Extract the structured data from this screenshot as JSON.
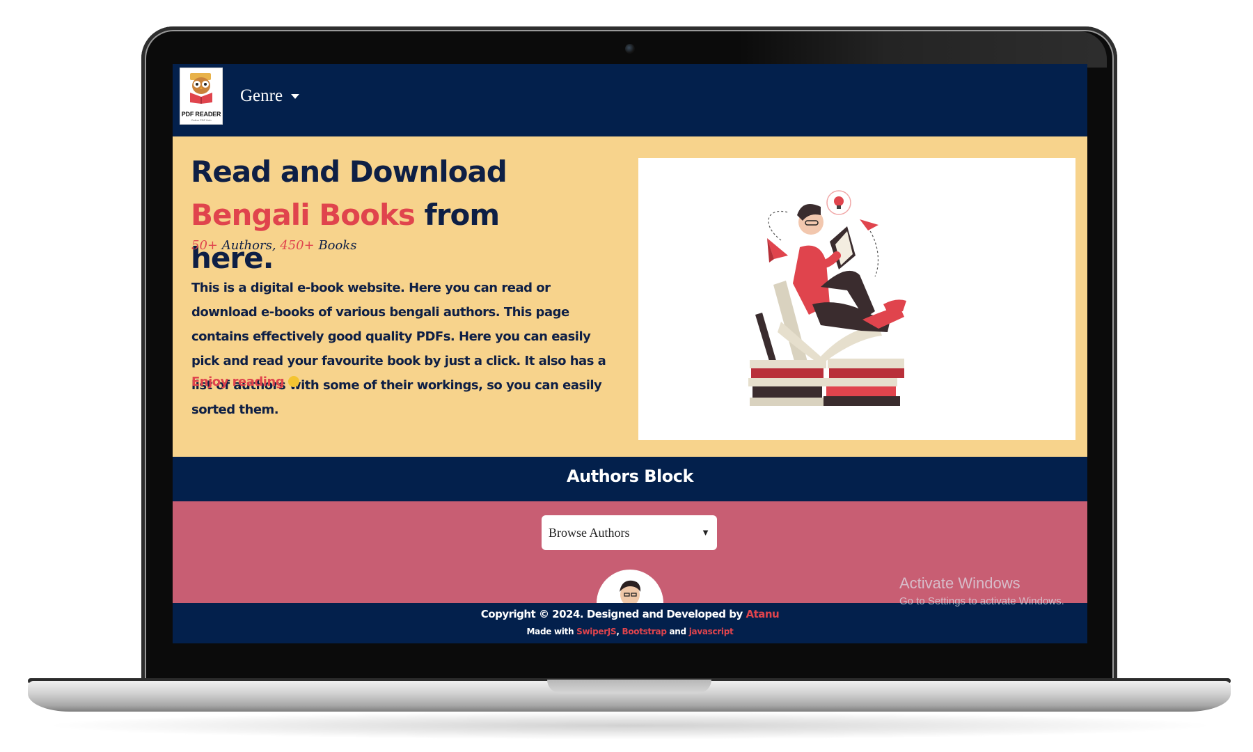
{
  "navbar": {
    "logo_text": "PDF READER",
    "logo_subtext": "Online PDF Hub",
    "genre_label": "Genre"
  },
  "hero": {
    "title_part1": "Read and Download ",
    "title_accent": "Bengali Books",
    "title_part2": " from here.",
    "stats_authors_count": "50+",
    "stats_authors_label": " Authors, ",
    "stats_books_count": "450+",
    "stats_books_label": " Books",
    "description": "This is a digital e-book website. Here you can read or download e-books of various bengali authors. This page contains effectively good quality PDFs. Here you can easily pick and read your favourite book by just a click. It also has a list of authors with some of their workings, so you can easily sorted them.",
    "enjoy_text": "Enjoy reading"
  },
  "authors": {
    "title": "Authors Block",
    "select_value": "Browse Authors"
  },
  "footer": {
    "copyright_text": "Copyright © 2024. Designed and Developed by ",
    "developer": "Atanu",
    "made_with": "Made with ",
    "tech1": "SwiperJS",
    "sep1": ", ",
    "tech2": "Bootstrap",
    "sep2": " and ",
    "tech3": "javascript"
  },
  "watermark": {
    "line1": "Activate Windows",
    "line2": "Go to Settings to activate Windows."
  },
  "colors": {
    "navy": "#03204c",
    "sand": "#f7d38c",
    "accent_red": "#e0444d",
    "rose": "#c85e73"
  }
}
